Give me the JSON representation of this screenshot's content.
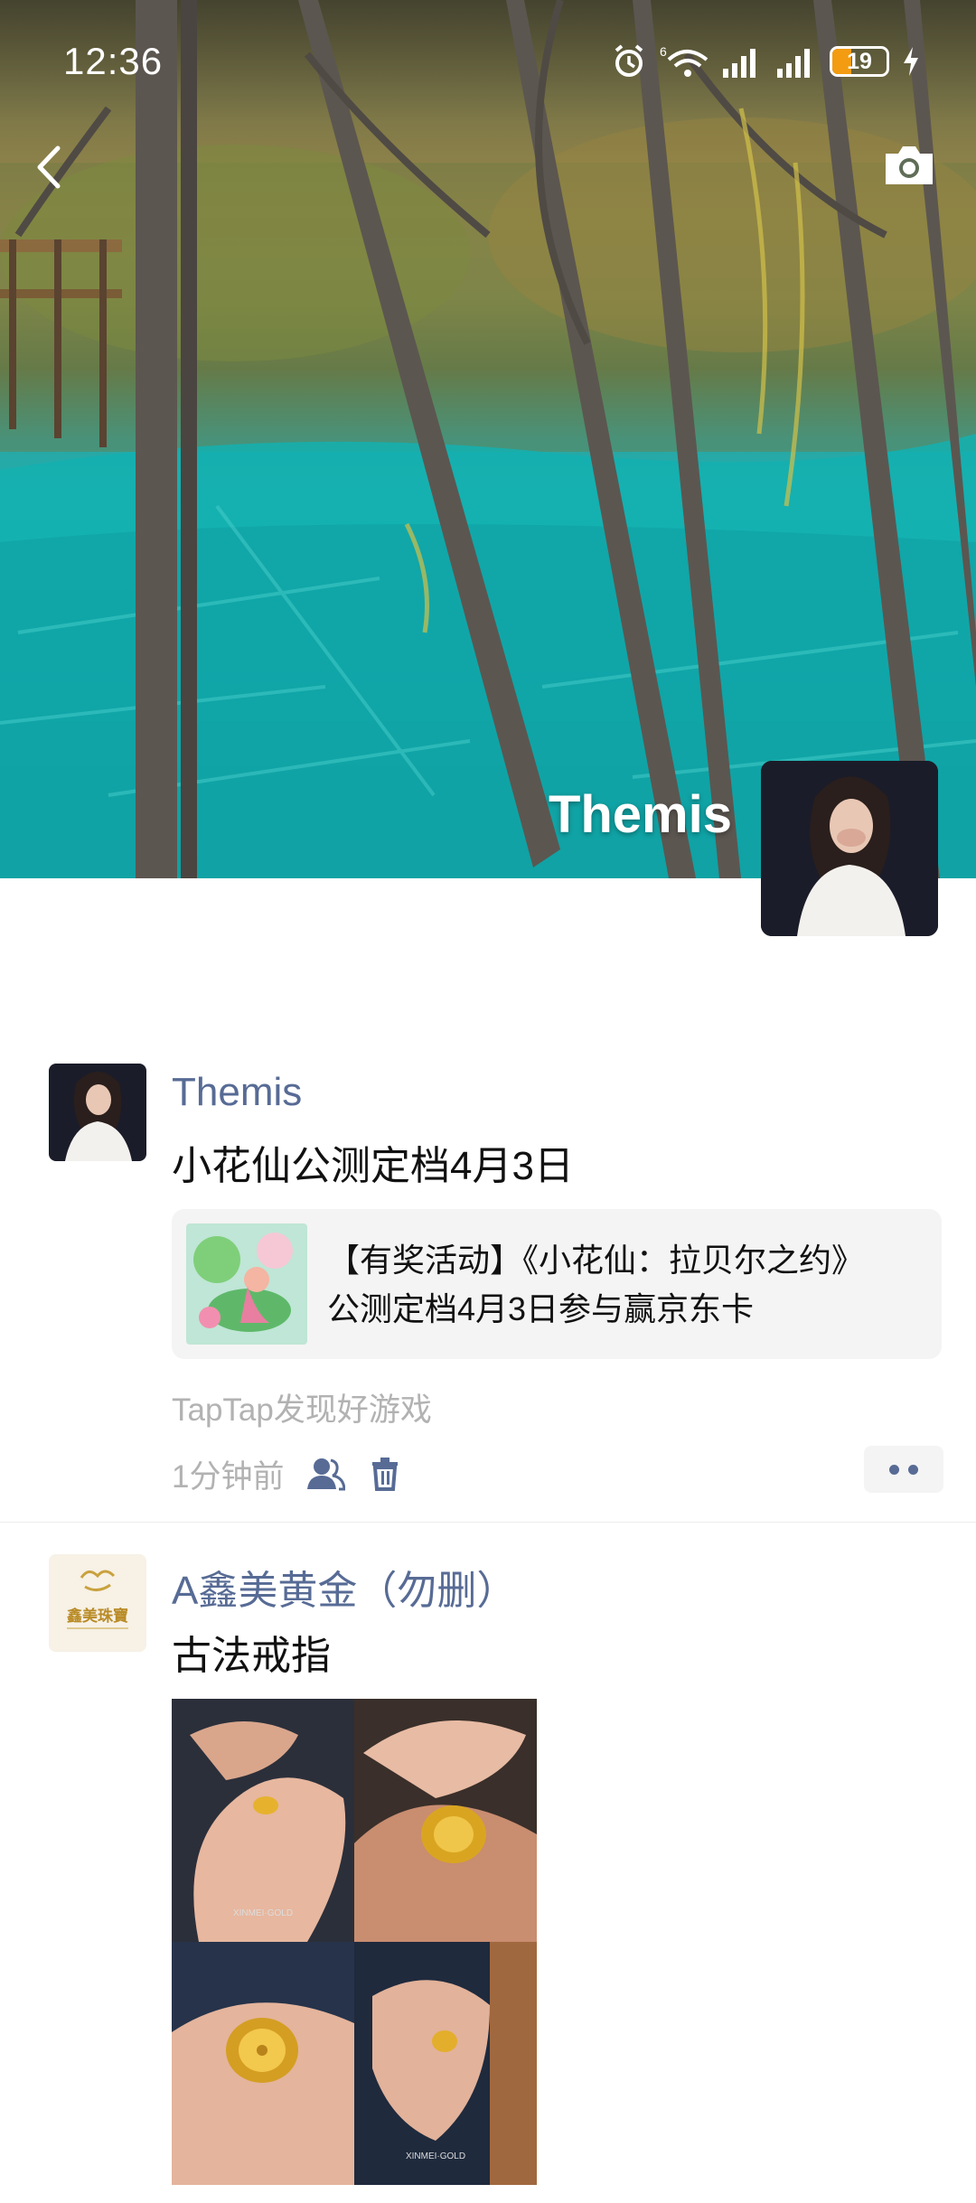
{
  "status_bar": {
    "time": "12:36",
    "battery": "19",
    "network": "6",
    "icons": [
      "alarm-icon",
      "wifi-icon",
      "signal-icon",
      "signal-icon",
      "battery-icon",
      "charging-icon"
    ]
  },
  "header": {
    "back_icon": "back-chevron-icon",
    "camera_icon": "camera-icon"
  },
  "profile": {
    "name": "Themis"
  },
  "posts": [
    {
      "author": "Themis",
      "text": "小花仙公测定档4月3日",
      "link": {
        "title_line1": "【有奖活动】《小花仙：拉贝尔之约》",
        "title_line2": "公测定档4月3日参与赢京东卡"
      },
      "source": "TapTap发现好游戏",
      "time": "1分钟前"
    },
    {
      "author": "A鑫美黄金（勿删）",
      "text": "古法戒指",
      "avatar_text": "鑫美珠寶",
      "photo_watermark": "XINMEI·GOLD"
    }
  ],
  "colors": {
    "name_link": "#576b95",
    "meta_gray": "#b2b2b2",
    "card_bg": "#f4f4f4",
    "battery_accent": "#f39c12"
  }
}
